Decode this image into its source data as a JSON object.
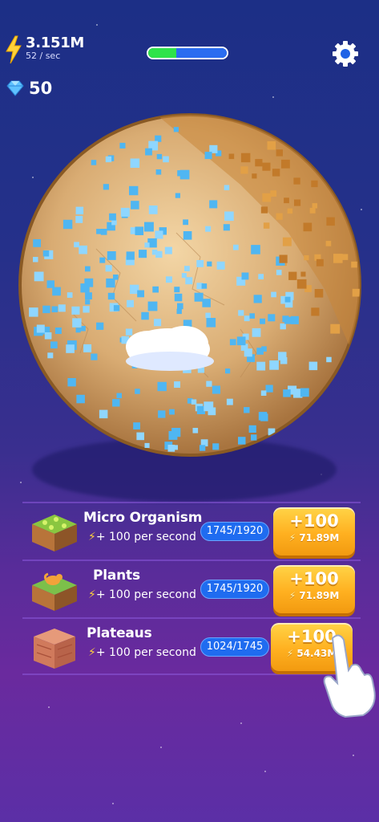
{
  "hud": {
    "energy_amount": "3.151M",
    "energy_rate": "52 / sec",
    "gem_count": "50",
    "progress_green": 0.36,
    "progress_blue": 0.64
  },
  "icons": {
    "energy": "lightning-bolt-icon",
    "gem": "gem-icon",
    "settings": "gear-icon"
  },
  "upgrades": [
    {
      "name": "Micro Organism",
      "desc": "+ 100 per second",
      "count": "1745/1920",
      "buy_label": "+100",
      "cost": "71.89M"
    },
    {
      "name": "Plants",
      "desc": "+ 100 per second",
      "count": "1745/1920",
      "buy_label": "+100",
      "cost": "71.89M"
    },
    {
      "name": "Plateaus",
      "desc": "+ 100 per second",
      "count": "1024/1745",
      "buy_label": "+100",
      "cost": "54.43M"
    }
  ],
  "colors": {
    "accent_yellow": "#ffb020",
    "pill_blue": "#1f6cf0",
    "progress_green": "#2ee34a",
    "progress_blue": "#2a6df0"
  }
}
